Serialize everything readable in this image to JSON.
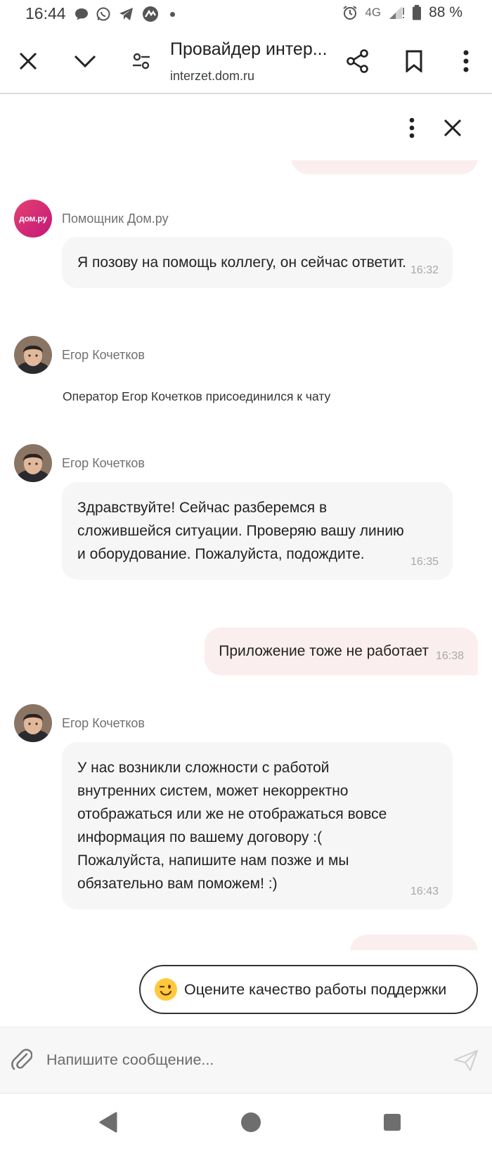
{
  "status_bar": {
    "time": "16:44",
    "network": "4G",
    "battery": "88 %"
  },
  "toolbar": {
    "title": "Провайдер интер...",
    "url": "interzet.dom.ru"
  },
  "chat": {
    "bot": {
      "name": "Помощник Дом.ру",
      "avatar_text": "дом.ру",
      "message": "Я позову на помощь коллегу, он сейчас ответит.",
      "time": "16:32"
    },
    "operator_joined": {
      "name": "Егор Кочетков",
      "text": "Оператор Егор Кочетков присоединился к чату"
    },
    "operator_msg1": {
      "name": "Егор Кочетков",
      "message": "Здравствуйте! Сейчас разберемся в сложившейся ситуации. Проверяю вашу линию и оборудование. Пожалуйста, подождите.",
      "time": "16:35"
    },
    "user_msg": {
      "message": "Приложение тоже не работает",
      "time": "16:38"
    },
    "operator_msg2": {
      "name": "Егор Кочетков",
      "message": "У нас возникли сложности с работой внутренних систем, может некорректно отображаться или же не отображаться вовсе информация по вашему договору :( Пожалуйста, напишите нам позже и мы обязательно вам поможем! :)",
      "time": "16:43"
    }
  },
  "rating": {
    "label": "Оцените качество работы поддержки",
    "emoji": "winking-face"
  },
  "input": {
    "placeholder": "Напишите сообщение...",
    "value": ""
  },
  "colors": {
    "sent_bubble": "#fbeeee",
    "received_bubble": "#f6f6f6",
    "brand": "#d9266f"
  }
}
